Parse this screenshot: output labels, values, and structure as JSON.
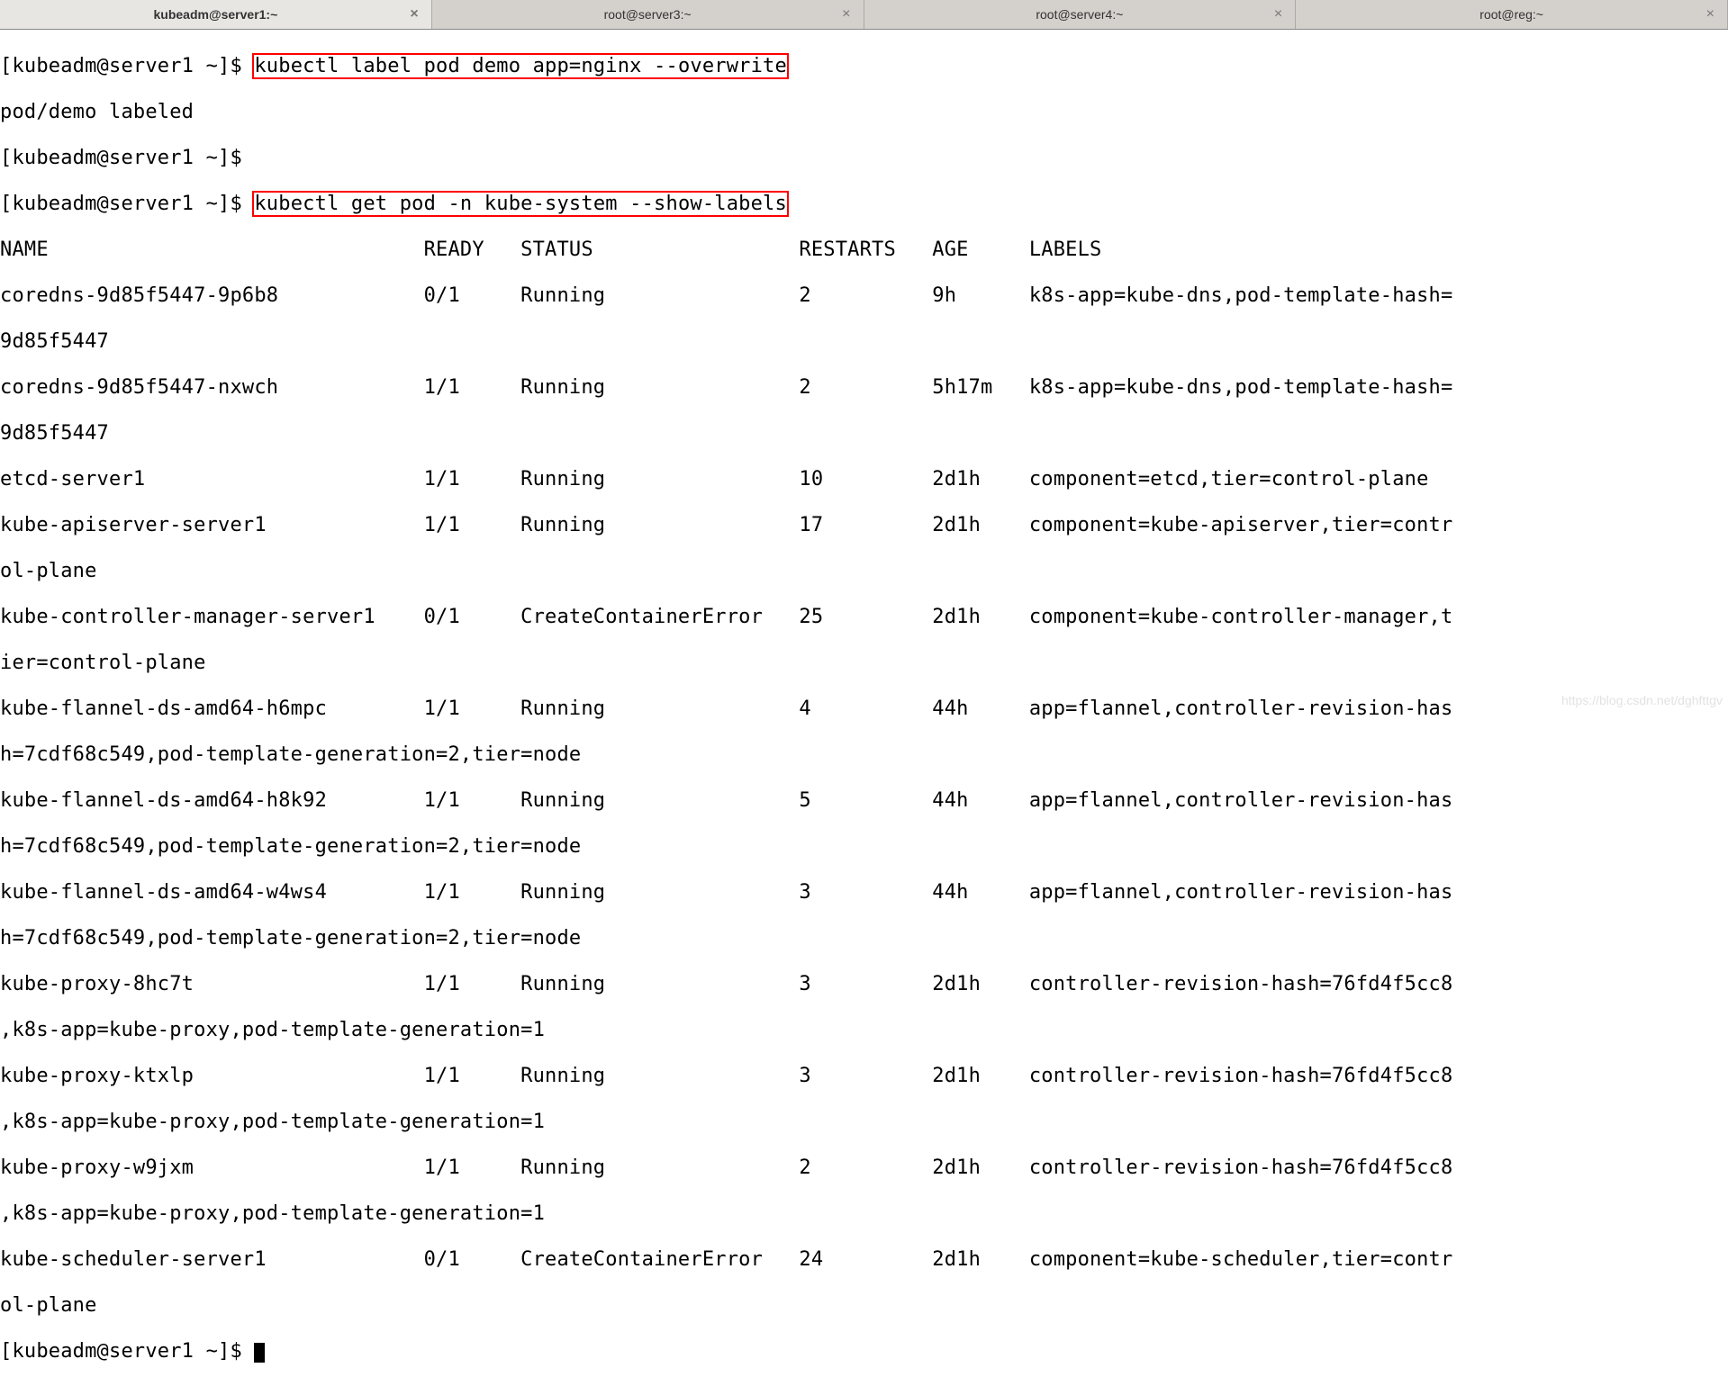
{
  "tabs": [
    {
      "label": "kubeadm@server1:~",
      "active": true
    },
    {
      "label": "root@server3:~",
      "active": false
    },
    {
      "label": "root@server4:~",
      "active": false
    },
    {
      "label": "root@reg:~",
      "active": false
    }
  ],
  "close_glyph": "×",
  "prompt": "[kubeadm@server1 ~]$",
  "cmd1": "kubectl label pod demo app=nginx --overwrite",
  "out1": "pod/demo labeled",
  "cmd2": "kubectl get pod -n kube-system --show-labels",
  "header": "NAME                               READY   STATUS                 RESTARTS   AGE     LABELS",
  "rows": [
    "coredns-9d85f5447-9p6b8            0/1     Running                2          9h      k8s-app=kube-dns,pod-template-hash=",
    "9d85f5447",
    "coredns-9d85f5447-nxwch            1/1     Running                2          5h17m   k8s-app=kube-dns,pod-template-hash=",
    "9d85f5447",
    "etcd-server1                       1/1     Running                10         2d1h    component=etcd,tier=control-plane",
    "kube-apiserver-server1             1/1     Running                17         2d1h    component=kube-apiserver,tier=contr",
    "ol-plane",
    "kube-controller-manager-server1    0/1     CreateContainerError   25         2d1h    component=kube-controller-manager,t",
    "ier=control-plane",
    "kube-flannel-ds-amd64-h6mpc        1/1     Running                4          44h     app=flannel,controller-revision-has",
    "h=7cdf68c549,pod-template-generation=2,tier=node",
    "kube-flannel-ds-amd64-h8k92        1/1     Running                5          44h     app=flannel,controller-revision-has",
    "h=7cdf68c549,pod-template-generation=2,tier=node",
    "kube-flannel-ds-amd64-w4ws4        1/1     Running                3          44h     app=flannel,controller-revision-has",
    "h=7cdf68c549,pod-template-generation=2,tier=node",
    "kube-proxy-8hc7t                   1/1     Running                3          2d1h    controller-revision-hash=76fd4f5cc8",
    ",k8s-app=kube-proxy,pod-template-generation=1",
    "kube-proxy-ktxlp                   1/1     Running                3          2d1h    controller-revision-hash=76fd4f5cc8",
    ",k8s-app=kube-proxy,pod-template-generation=1",
    "kube-proxy-w9jxm                   1/1     Running                2          2d1h    controller-revision-hash=76fd4f5cc8",
    ",k8s-app=kube-proxy,pod-template-generation=1",
    "kube-scheduler-server1             0/1     CreateContainerError   24         2d1h    component=kube-scheduler,tier=contr",
    "ol-plane"
  ],
  "watermark": "https://blog.csdn.net/dghfttgv"
}
